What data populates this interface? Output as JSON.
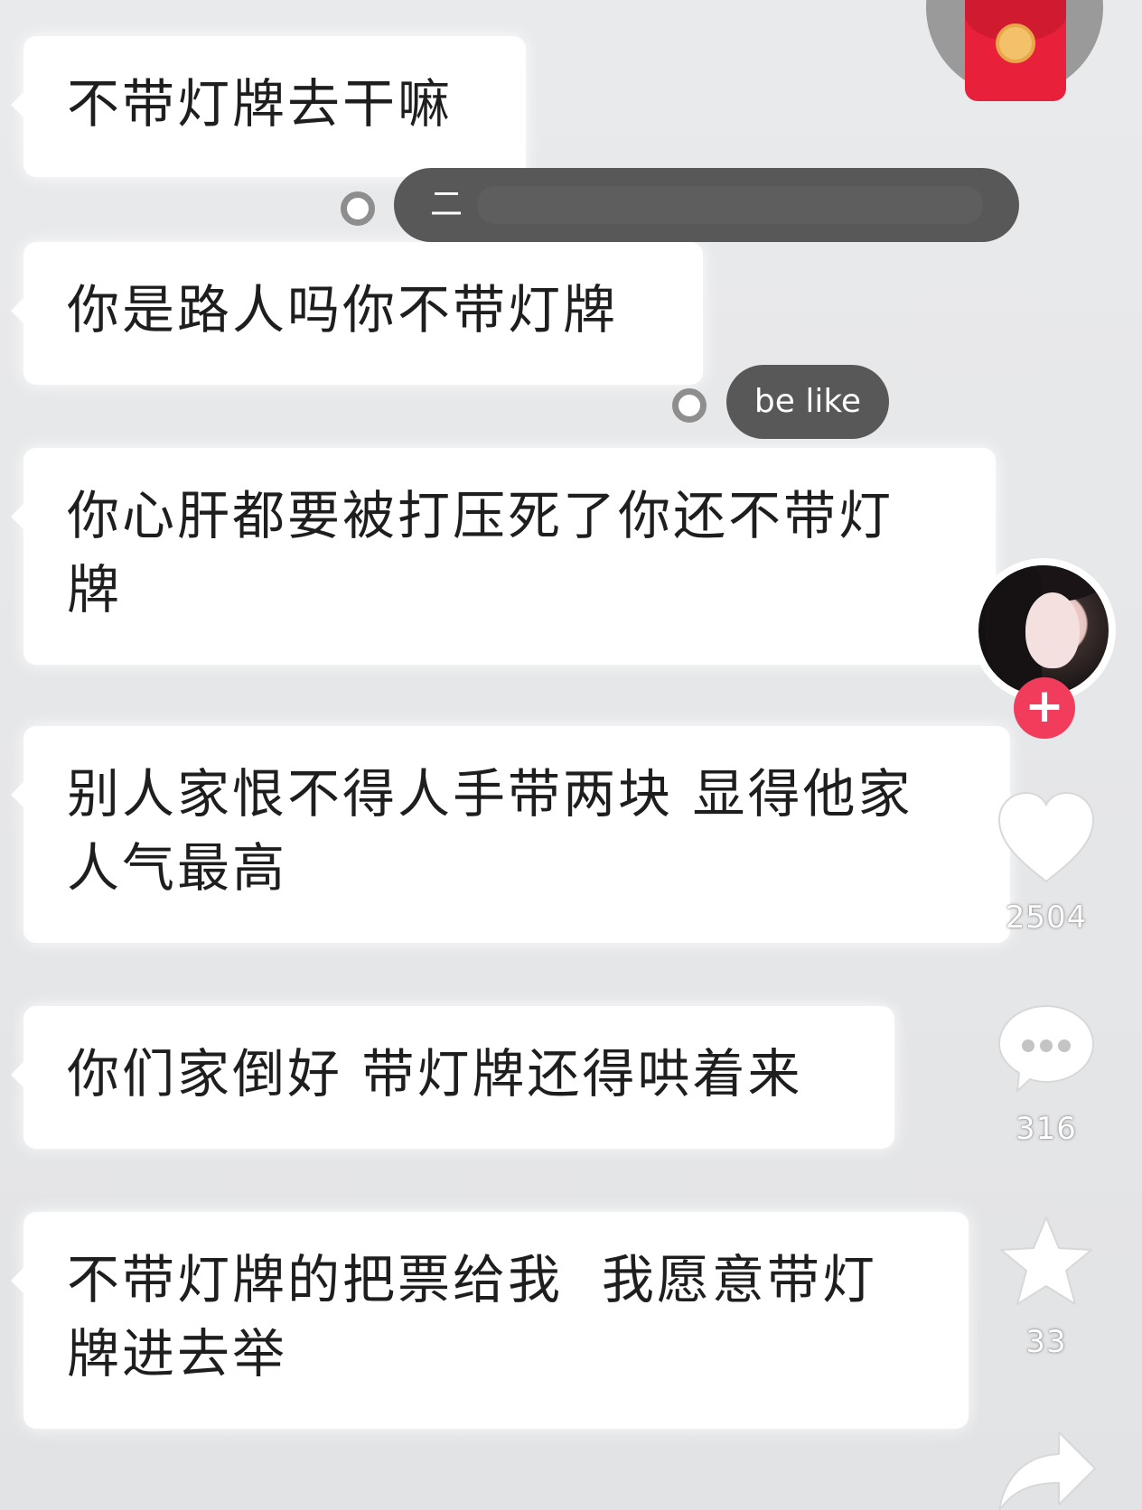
{
  "messages": [
    {
      "text": "不带灯牌去干嘛"
    },
    {
      "text": "你是路人吗你不带灯牌"
    },
    {
      "text": "你心肝都要被打压死了你还不带灯\n牌"
    },
    {
      "text": "别人家恨不得人手带两块 显得他家\n人气最高"
    },
    {
      "text": "你们家倒好 带灯牌还得哄着来"
    },
    {
      "text": "不带灯牌的把票给我  我愿意带灯\n牌进去举"
    }
  ],
  "danmaku": [
    {
      "text": "二"
    },
    {
      "text": "be like"
    }
  ],
  "sidebar": {
    "likes": "2504",
    "comments": "316",
    "favorites": "33",
    "follow_label": "+"
  },
  "colors": {
    "follow_button": "#f23c5c",
    "red_packet": "#e8203a",
    "danmaku_bg": "#585858"
  },
  "icons": [
    "red-packet-icon",
    "heart-icon",
    "comment-icon",
    "star-icon",
    "share-icon",
    "plus-icon"
  ]
}
